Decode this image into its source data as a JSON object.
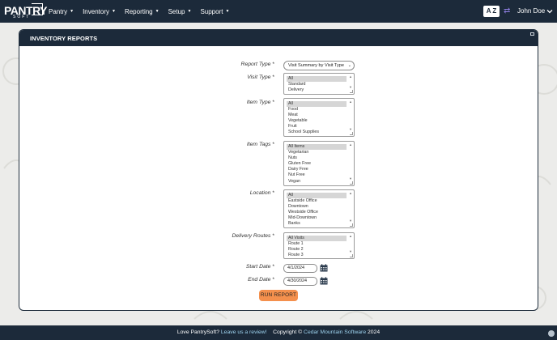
{
  "brand": {
    "name": "PANTRY",
    "sub": "SOFT"
  },
  "nav": {
    "items": [
      {
        "label": "Pantry"
      },
      {
        "label": "Inventory"
      },
      {
        "label": "Reporting"
      },
      {
        "label": "Setup"
      },
      {
        "label": "Support"
      }
    ],
    "az_label": "A Z",
    "user_name": "John Doe"
  },
  "panel": {
    "title": "INVENTORY REPORTS"
  },
  "form": {
    "report_type": {
      "label": "Report Type",
      "value": "Visit Summary by Visit Type"
    },
    "visit_type": {
      "label": "Visit Type",
      "options": [
        "All",
        "Standard",
        "Delivery"
      ]
    },
    "item_type": {
      "label": "Item Type",
      "options": [
        "All",
        "Food",
        "Meat",
        "Vegetable",
        "Fruit",
        "School Supplies"
      ]
    },
    "item_tags": {
      "label": "Item Tags",
      "options": [
        "All Items",
        "Vegetarian",
        "Nuts",
        "Gluten Free",
        "Dairy Free",
        "Nut Free",
        "Vegan"
      ]
    },
    "location": {
      "label": "Location",
      "options": [
        "All",
        "Eastside Office",
        "Downtown",
        "Westside Office",
        "Mid-Downtown",
        "Banks"
      ]
    },
    "delivery_routes": {
      "label": "Delivery Routes",
      "options": [
        "All Visits",
        "Route 1",
        "Route 2",
        "Route 3"
      ]
    },
    "start_date": {
      "label": "Start Date",
      "value": "4/1/2024"
    },
    "end_date": {
      "label": "End Date",
      "value": "4/30/2024"
    },
    "required_mark": "*",
    "run_label": "RUN REPORT"
  },
  "footer": {
    "love": "Love PantrySoft?",
    "review_link": "Leave us a review!",
    "copyright": "Copyright ©",
    "company_link": "Cedar Mountain Software",
    "year": "2024"
  },
  "colors": {
    "nav_bg": "#1c2a3a",
    "accent_orange": "#f4904d",
    "link_blue": "#9ed3ee",
    "page_bg": "#ececea"
  }
}
